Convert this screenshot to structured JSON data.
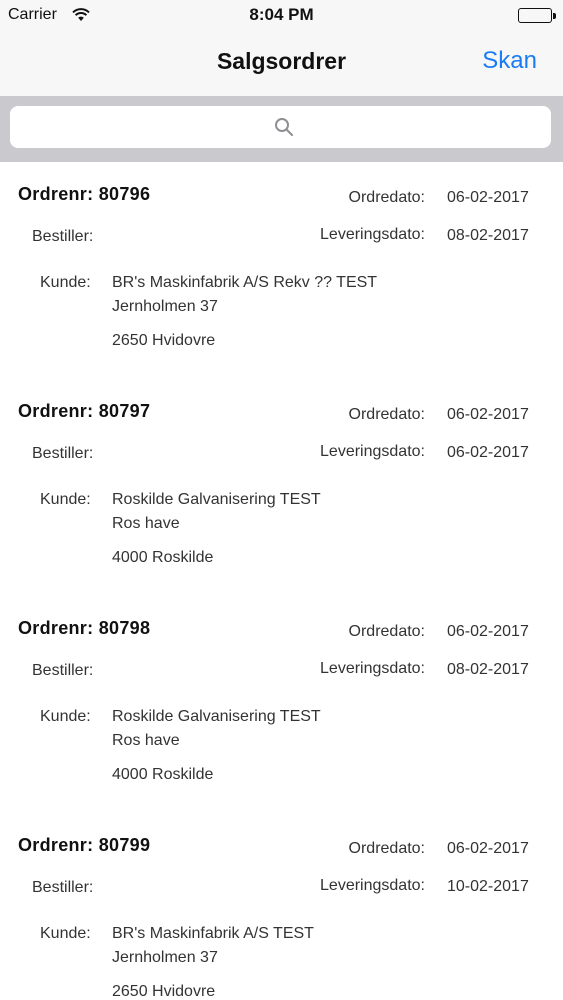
{
  "status_bar": {
    "carrier": "Carrier",
    "time": "8:04 PM",
    "wifi_icon": "wifi-icon",
    "battery_icon": "battery-icon"
  },
  "nav": {
    "title": "Salgsordrer",
    "action_label": "Skan"
  },
  "search": {
    "icon": "search-icon",
    "placeholder": ""
  },
  "labels": {
    "order_prefix": "Ordrenr:",
    "order_date": "Ordredato:",
    "bestiller": "Bestiller:",
    "delivery_date": "Leveringsdato:",
    "kunde": "Kunde:"
  },
  "orders": [
    {
      "order_no": "Ordrenr: 80796",
      "order_date": "06-02-2017",
      "bestiller": "",
      "delivery_date": "08-02-2017",
      "customer_name": "BR's Maskinfabrik A/S Rekv ?? TEST",
      "address": "Jernholmen 37",
      "city": "2650  Hvidovre"
    },
    {
      "order_no": "Ordrenr: 80797",
      "order_date": "06-02-2017",
      "bestiller": "",
      "delivery_date": "06-02-2017",
      "customer_name": "Roskilde Galvanisering TEST",
      "address": "Ros have",
      "city": "4000  Roskilde"
    },
    {
      "order_no": "Ordrenr: 80798",
      "order_date": "06-02-2017",
      "bestiller": "",
      "delivery_date": "08-02-2017",
      "customer_name": "Roskilde Galvanisering TEST",
      "address": "Ros have",
      "city": "4000  Roskilde"
    },
    {
      "order_no": "Ordrenr: 80799",
      "order_date": "06-02-2017",
      "bestiller": "",
      "delivery_date": "10-02-2017",
      "customer_name": "BR's Maskinfabrik A/S TEST",
      "address": "Jernholmen 37",
      "city": "2650  Hvidovre"
    }
  ],
  "colors": {
    "accent": "#1a7cf5",
    "search_background": "#c9c9ce",
    "bar_background": "#f7f7f7"
  }
}
